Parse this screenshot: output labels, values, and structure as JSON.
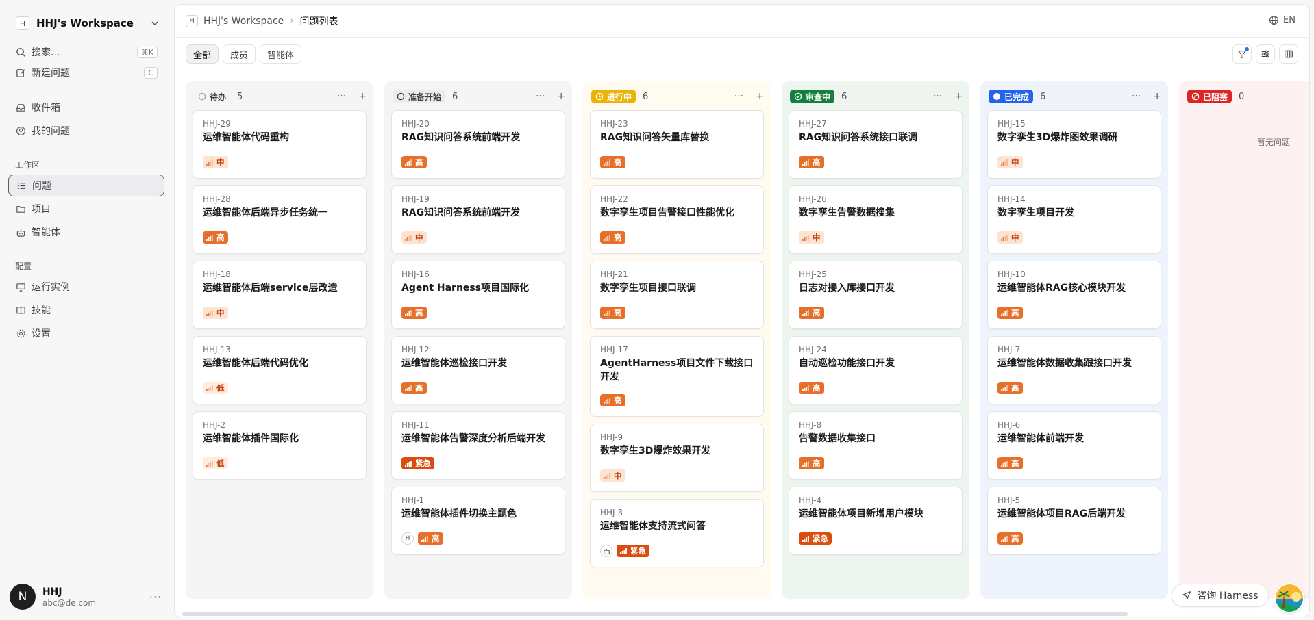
{
  "workspace": {
    "initial": "H",
    "name": "HHJ's Workspace"
  },
  "sidebar": {
    "search": {
      "label": "搜索...",
      "shortcut": "⌘K"
    },
    "new_issue": {
      "label": "新建问题",
      "shortcut": "C"
    },
    "inbox": "收件箱",
    "my_issues": "我的问题",
    "section_workspace": "工作区",
    "issues": "问题",
    "projects": "项目",
    "agents": "智能体",
    "section_config": "配置",
    "runtimes": "运行实例",
    "skills": "技能",
    "settings": "设置"
  },
  "user": {
    "initial": "N",
    "name": "HHJ",
    "email": "abc@de.com",
    "more": "···"
  },
  "breadcrumb": {
    "initial": "H",
    "workspace": "HHJ's Workspace",
    "sep": "›",
    "current": "问题列表"
  },
  "lang": "EN",
  "filters": [
    "全部",
    "成员",
    "智能体"
  ],
  "colors": {
    "accent_high": "#e66f29",
    "accent_urgent": "#d94d0f",
    "done": "#2563eb",
    "review": "#15803d",
    "progress": "#eab308",
    "blocked": "#dc2626"
  },
  "columns": [
    {
      "status": "待办",
      "count": "5",
      "cards": [
        {
          "id": "HHJ-29",
          "title": "运维智能体代码重构",
          "priority": "中"
        },
        {
          "id": "HHJ-28",
          "title": "运维智能体后端异步任务统一",
          "priority": "高"
        },
        {
          "id": "HHJ-18",
          "title": "运维智能体后端service层改造",
          "priority": "中"
        },
        {
          "id": "HHJ-13",
          "title": "运维智能体后端代码优化",
          "priority": "低"
        },
        {
          "id": "HHJ-2",
          "title": "运维智能体插件国际化",
          "priority": "低"
        }
      ]
    },
    {
      "status": "准备开始",
      "count": "6",
      "cards": [
        {
          "id": "HHJ-20",
          "title": "RAG知识问答系统前端开发",
          "priority": "高"
        },
        {
          "id": "HHJ-19",
          "title": "RAG知识问答系统前端开发",
          "priority": "中"
        },
        {
          "id": "HHJ-16",
          "title": "Agent Harness项目国际化",
          "priority": "高"
        },
        {
          "id": "HHJ-12",
          "title": "运维智能体巡检接口开发",
          "priority": "高"
        },
        {
          "id": "HHJ-11",
          "title": "运维智能体告警深度分析后端开发",
          "priority": "紧急"
        },
        {
          "id": "HHJ-1",
          "title": "运维智能体插件切换主题色",
          "priority": "高",
          "assignee": "H"
        }
      ]
    },
    {
      "status": "进行中",
      "count": "6",
      "cards": [
        {
          "id": "HHJ-23",
          "title": "RAG知识问答矢量库替换",
          "priority": "高"
        },
        {
          "id": "HHJ-22",
          "title": "数字孪生项目告警接口性能优化",
          "priority": "高"
        },
        {
          "id": "HHJ-21",
          "title": "数字孪生项目接口联调",
          "priority": "高"
        },
        {
          "id": "HHJ-17",
          "title": "AgentHarness项目文件下载接口开发",
          "priority": "高"
        },
        {
          "id": "HHJ-9",
          "title": "数字孪生3D爆炸效果开发",
          "priority": "中"
        },
        {
          "id": "HHJ-3",
          "title": "运维智能体支持流式问答",
          "priority": "紧急",
          "bot": true
        }
      ]
    },
    {
      "status": "审查中",
      "count": "6",
      "cards": [
        {
          "id": "HHJ-27",
          "title": "RAG知识问答系统接口联调",
          "priority": "高"
        },
        {
          "id": "HHJ-26",
          "title": "数字孪生告警数据搜集",
          "priority": "中"
        },
        {
          "id": "HHJ-25",
          "title": "日志对接入库接口开发",
          "priority": "高"
        },
        {
          "id": "HHJ-24",
          "title": "自动巡检功能接口开发",
          "priority": "高"
        },
        {
          "id": "HHJ-8",
          "title": "告警数据收集接口",
          "priority": "高"
        },
        {
          "id": "HHJ-4",
          "title": "运维智能体项目新增用户模块",
          "priority": "紧急"
        }
      ]
    },
    {
      "status": "已完成",
      "count": "6",
      "cards": [
        {
          "id": "HHJ-15",
          "title": "数字孪生3D爆炸图效果调研",
          "priority": "中"
        },
        {
          "id": "HHJ-14",
          "title": "数字孪生项目开发",
          "priority": "中"
        },
        {
          "id": "HHJ-10",
          "title": "运维智能体RAG核心模块开发",
          "priority": "高"
        },
        {
          "id": "HHJ-7",
          "title": "运维智能体数据收集跟接口开发",
          "priority": "高"
        },
        {
          "id": "HHJ-6",
          "title": "运维智能体前端开发",
          "priority": "高"
        },
        {
          "id": "HHJ-5",
          "title": "运维智能体项目RAG后端开发",
          "priority": "高"
        }
      ]
    },
    {
      "status": "已阻塞",
      "count": "0",
      "empty_text": "暂无问题",
      "cards": []
    }
  ],
  "consult_button": "咨询 Harness"
}
